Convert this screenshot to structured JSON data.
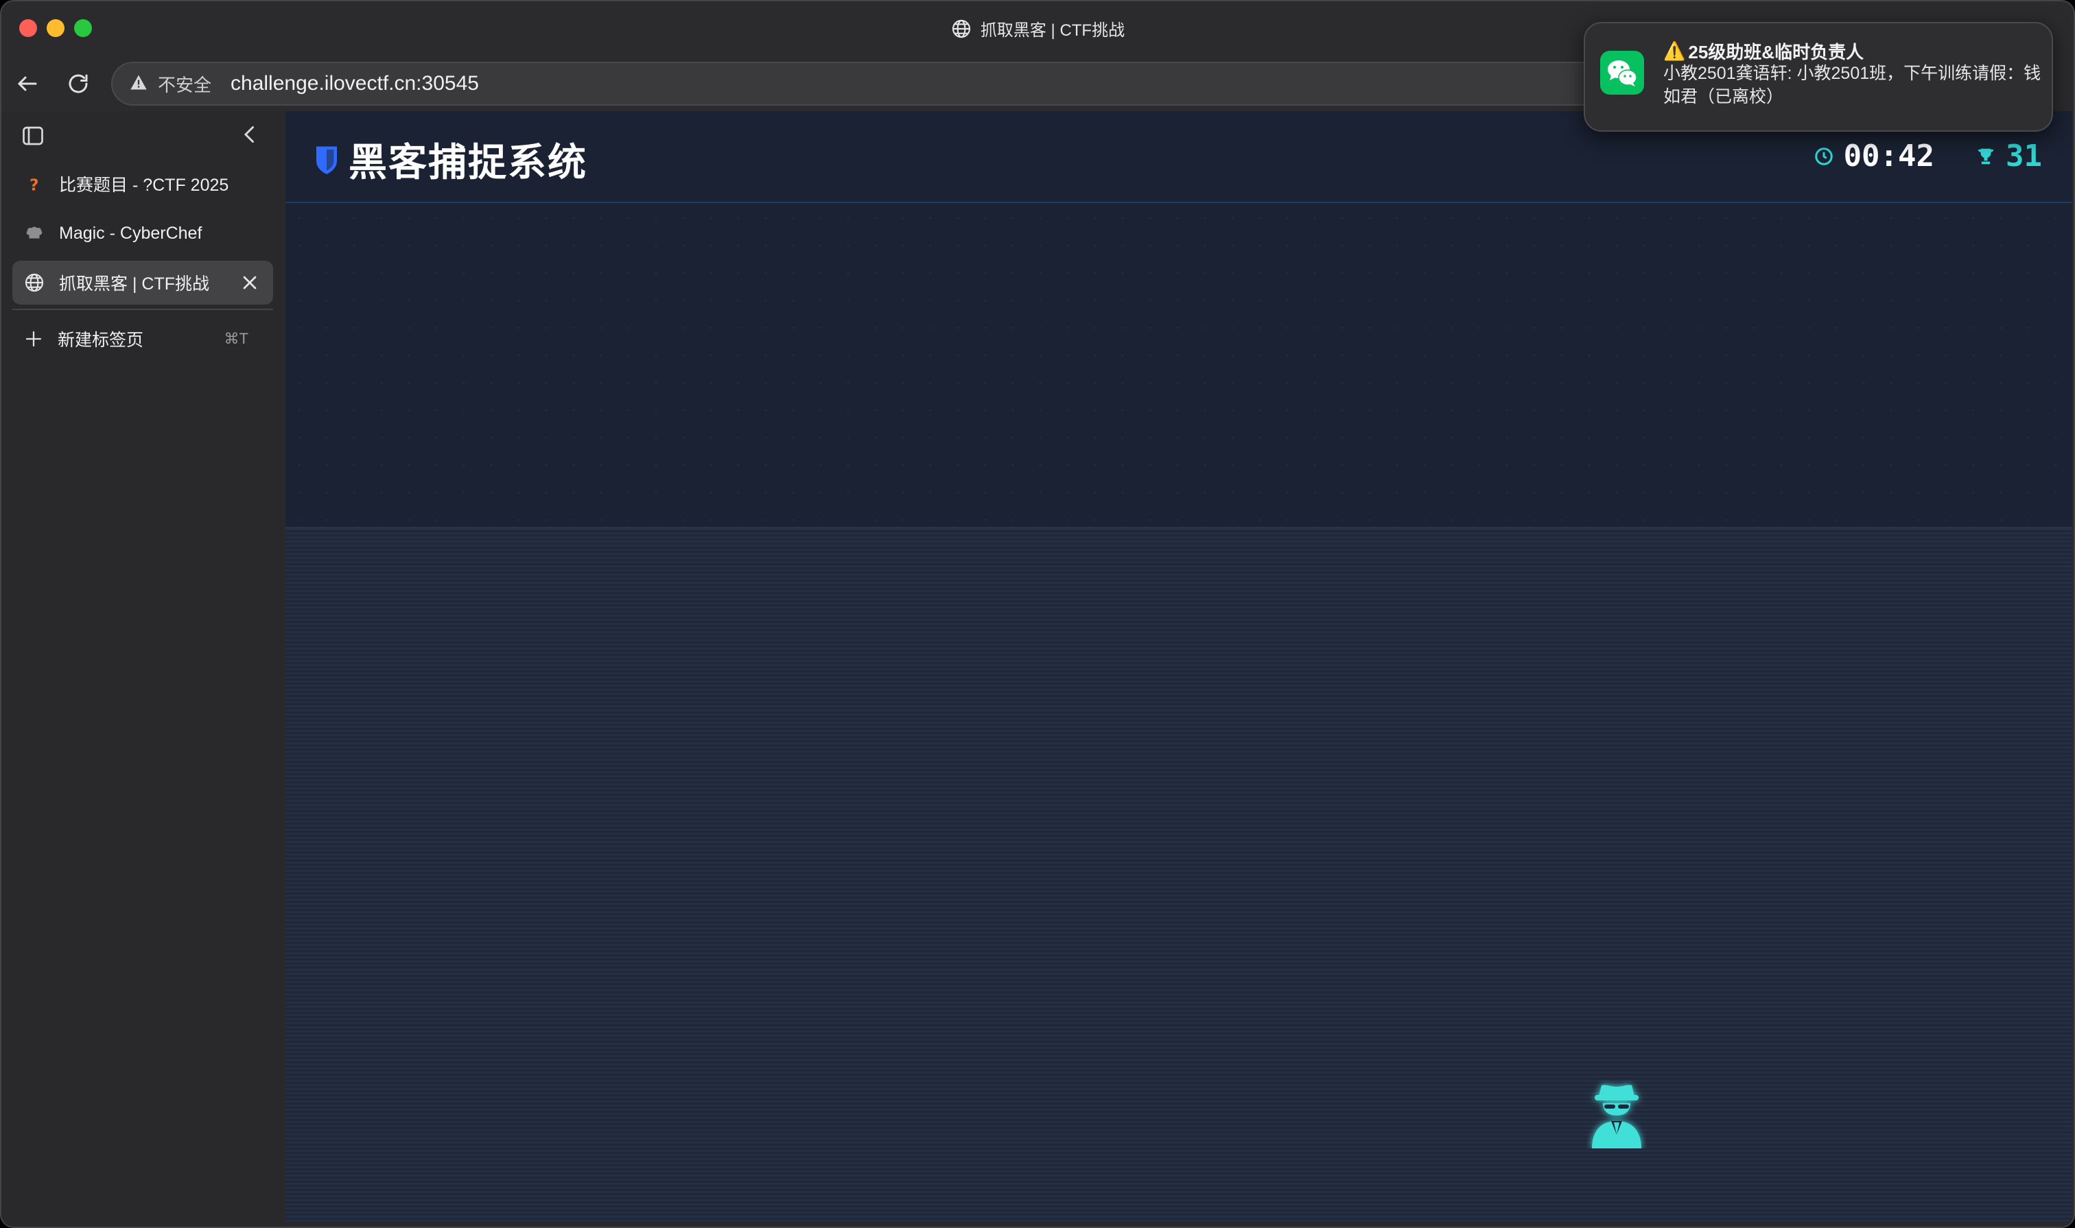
{
  "window": {
    "title": "抓取黑客 | CTF挑战"
  },
  "toolbar": {
    "insecure_label": "不安全",
    "url": "challenge.ilovectf.cn:30545"
  },
  "sidebar": {
    "tabs": [
      {
        "label": "比赛题目 - ?CTF 2025",
        "icon": "question-favicon"
      },
      {
        "label": "Magic - CyberChef",
        "icon": "chef-hat-favicon"
      },
      {
        "label": "抓取黑客 | CTF挑战",
        "icon": "globe-icon",
        "active": true
      }
    ],
    "new_tab": {
      "label": "新建标签页",
      "shortcut": "⌘T"
    }
  },
  "app": {
    "title": "黑客捕捉系统",
    "timer": "00:42",
    "score": "31",
    "accent": "#30d5d2",
    "title_icon_color": "#2f6bff"
  },
  "notification": {
    "app": "WeChat",
    "title": "25级助班&临时负责人",
    "warning_glyph": "⚠️",
    "body": "小教2501龚语轩: 小教2501班，下午训练请假：钱如君（已离校）"
  }
}
